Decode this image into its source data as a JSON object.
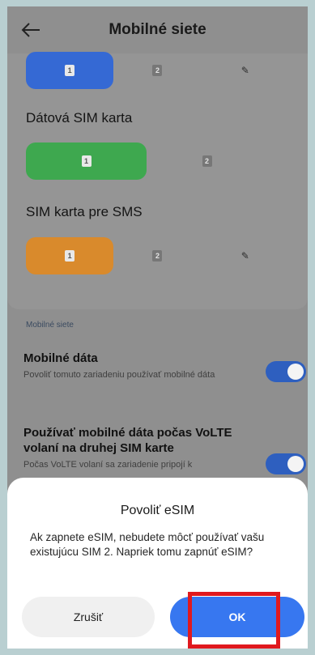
{
  "header": {
    "title": "Mobilné siete",
    "back_icon": "arrow-left-icon"
  },
  "sim_rows": [
    {
      "label": "",
      "active_color": "#3569d4",
      "items": [
        "1",
        "2",
        "pencil-icon"
      ]
    },
    {
      "label": "Dátová SIM karta",
      "active_color": "#3ea84f",
      "items": [
        "1",
        "2"
      ]
    },
    {
      "label": "SIM karta pre SMS",
      "active_color": "#d98a2c",
      "items": [
        "1",
        "2",
        "pencil-icon"
      ]
    }
  ],
  "section_header": "Mobilné siete",
  "settings": [
    {
      "title": "Mobilné dáta",
      "description": "Povoliť tomuto zariadeniu používať mobilné dáta",
      "toggle_on": true
    },
    {
      "title": "Používať mobilné dáta počas VoLTE volaní na druhej SIM karte",
      "description": "Počas VoLTE volaní sa zariadenie pripojí k",
      "toggle_on": true
    }
  ],
  "dialog": {
    "title": "Povoliť eSIM",
    "message": "Ak zapnete eSIM, nebudete môcť používať vašu existujúcu SIM 2. Napriek tomu zapnúť eSIM?",
    "cancel_label": "Zrušiť",
    "ok_label": "OK"
  },
  "colors": {
    "toggle": "#2e5fbf",
    "ok_button": "#3777f0",
    "highlight_box": "#e0191e"
  }
}
